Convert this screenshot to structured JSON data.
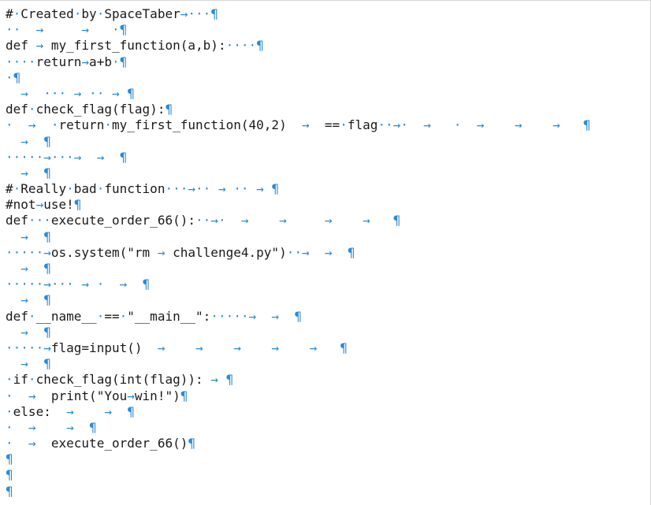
{
  "editor": {
    "lines": [
      "#·Created·by·SpaceTaber→···¶",
      "··  →     →   ·¶",
      "def → my_first_function(a,b):····¶",
      "····return→a+b·¶",
      "·¶",
      "  →  ··· → ·· → ¶",
      "def·check_flag(flag):¶",
      "·  →  ·return·my_first_function(40,2)  →  ==·flag··→·  →   ·  →    →    →   ¶",
      "  →  ¶",
      "·····→···→  →  ¶",
      "  →  ¶",
      "#·Really·bad·function···→·· → ·· → ¶",
      "#not→use!¶",
      "def···execute_order_66():··→·  →    →     →    →   ¶",
      "  →  ¶",
      "·····→os.system(\"rm → challenge4.py\")··→  →  ¶",
      "  →  ¶",
      "·····→··· → ·  →  ¶",
      "  →  ¶",
      "def·__name__·==·\"__main__\":·····→  →  ¶",
      "  →  ¶",
      "·····→flag=input()  →    →    →    →    →   ¶",
      "  →  ¶",
      "·if·check_flag(int(flag)): → ¶",
      "·  →  print(\"You→win!\")¶",
      "·else:  →    →  ¶",
      "·  →    →  ¶",
      "·  →  execute_order_66()¶",
      "¶",
      "¶",
      "¶"
    ]
  }
}
